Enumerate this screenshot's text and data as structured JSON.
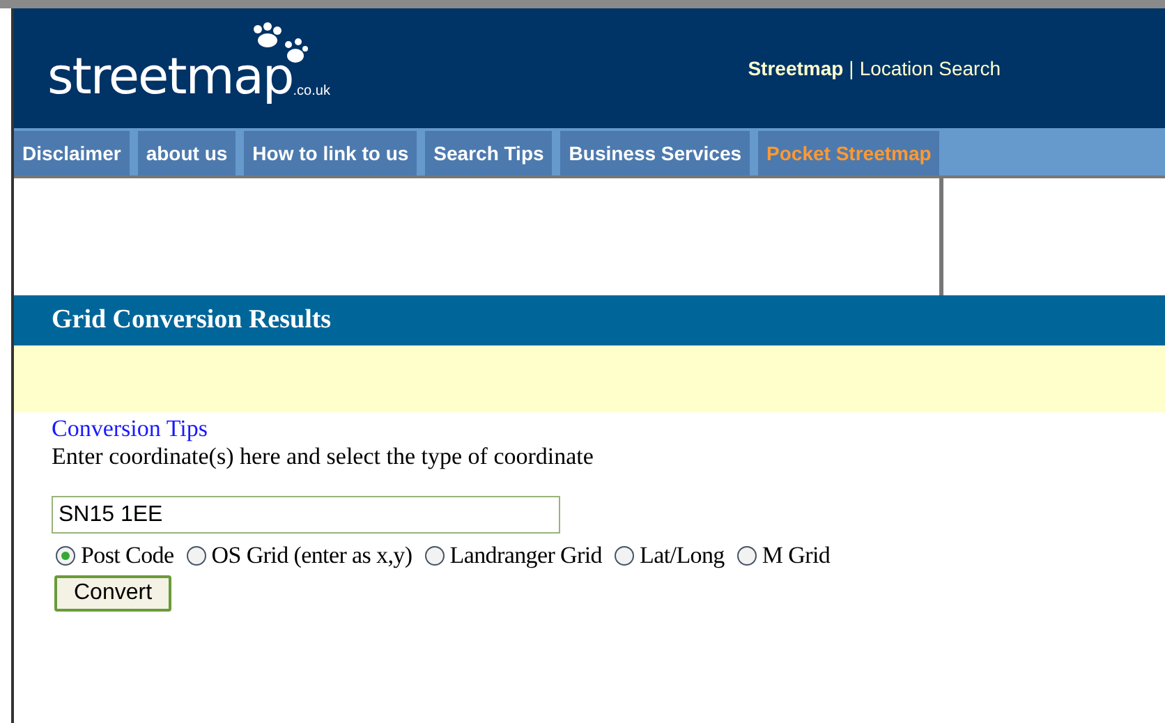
{
  "header": {
    "logo_text": "streetmap",
    "logo_suffix": ".co.uk",
    "tagline_bold": "Streetmap",
    "tagline_separator": "|",
    "tagline_link": "Location Search"
  },
  "nav": [
    {
      "label": "Disclaimer",
      "kind": "normal"
    },
    {
      "label": "about us",
      "kind": "normal"
    },
    {
      "label": "How to link to us",
      "kind": "normal"
    },
    {
      "label": "Search Tips",
      "kind": "normal"
    },
    {
      "label": "Business Services",
      "kind": "normal"
    },
    {
      "label": "Pocket Streetmap",
      "kind": "promo"
    }
  ],
  "section": {
    "title": "Grid Conversion Results"
  },
  "form": {
    "tips_link": "Conversion Tips",
    "instructions": "Enter coordinate(s) here and select the type of coordinate",
    "value": "SN15 1EE",
    "options": [
      {
        "label": "Post Code",
        "selected": true
      },
      {
        "label": "OS Grid (enter as x,y)",
        "selected": false
      },
      {
        "label": "Landranger Grid",
        "selected": false
      },
      {
        "label": "Lat/Long",
        "selected": false
      },
      {
        "label": "M Grid",
        "selected": false
      }
    ],
    "button": "Convert"
  }
}
